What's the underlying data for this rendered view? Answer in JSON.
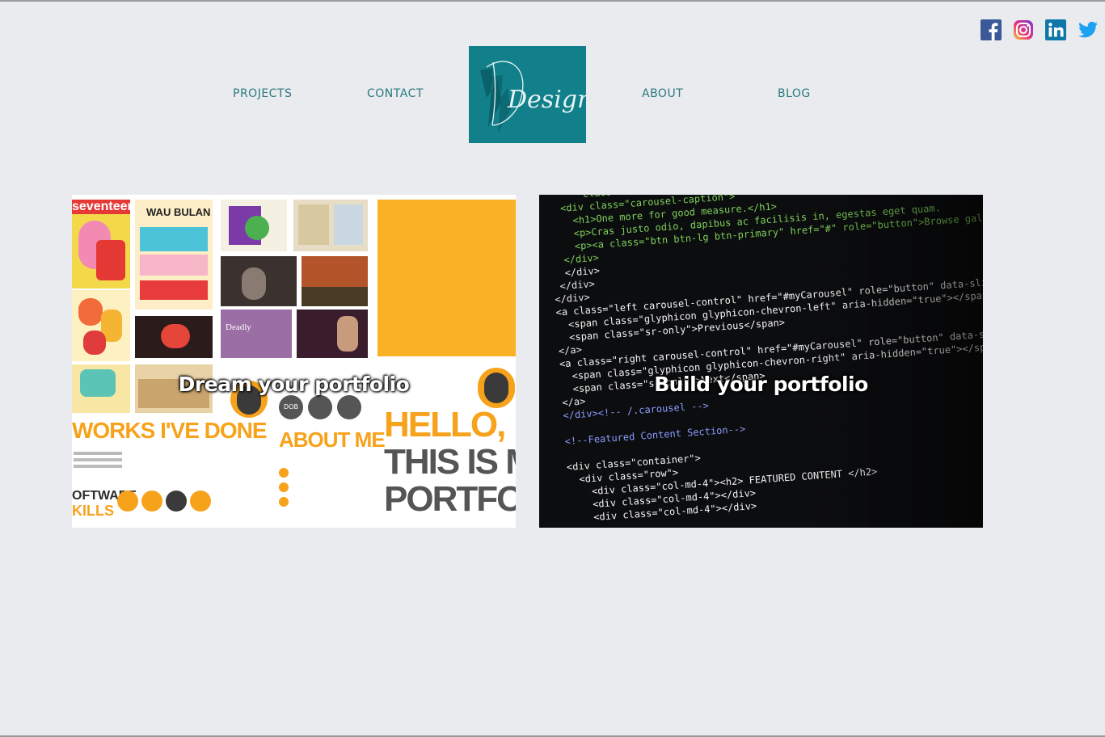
{
  "nav": {
    "projects": "PROJECTS",
    "contact": "CONTACT",
    "about": "ABOUT",
    "blog": "BLOG"
  },
  "logo": {
    "text": "Design"
  },
  "social": [
    "facebook-icon",
    "instagram-icon",
    "linkedin-icon",
    "twitter-icon"
  ],
  "cards": [
    {
      "caption": "Dream your portfolio"
    },
    {
      "caption": "Build your portfolio"
    }
  ],
  "portfolio_sheet": {
    "works": "WORKS I'VE DONE",
    "about": "ABOUT ME",
    "hello": [
      "HELLO,",
      "THIS IS MY",
      "PORTFOLIO"
    ],
    "software": [
      "OFTWARE",
      "KILLS"
    ],
    "magazine": "seventeen",
    "wau": "WAU BULAN",
    "dob": "DOB"
  },
  "code_lines": [
    "      class=\"container\">",
    "  <div class=\"carousel-caption\">",
    "    <h1>One more for good measure.</h1>",
    "    <p>Cras justo odio, dapibus ac facilisis in, egestas eget quam.",
    "    <p><a class=\"btn btn-lg btn-primary\" href=\"#\" role=\"button\">Browse gallery</a>",
    "  </div>",
    "  </div>",
    " </div>",
    "</div>",
    "<a class=\"left carousel-control\" href=\"#myCarousel\" role=\"button\" data-slide=\"prev\">",
    "  <span class=\"glyphicon glyphicon-chevron-left\" aria-hidden=\"true\"></span>",
    "  <span class=\"sr-only\">Previous</span>",
    "</a>",
    "<a class=\"right carousel-control\" href=\"#myCarousel\" role=\"button\" data-slide=\"next\">",
    "  <span class=\"glyphicon glyphicon-chevron-right\" aria-hidden=\"true\"></span>",
    "  <span class=\"sr-only\">Next</span>",
    "</a>",
    "</div><!-- /.carousel -->",
    "",
    "<!--Featured Content Section-->",
    "",
    "<div class=\"container\">",
    "  <div class=\"row\">",
    "    <div class=\"col-md-4\"><h2> FEATURED CONTENT </h2>",
    "    <div class=\"col-md-4\"></div>",
    "    <div class=\"col-md-4\"></div>"
  ],
  "colors": {
    "accent": "#12808a",
    "nav_text": "#2b7a80",
    "background": "#e9ebee"
  }
}
